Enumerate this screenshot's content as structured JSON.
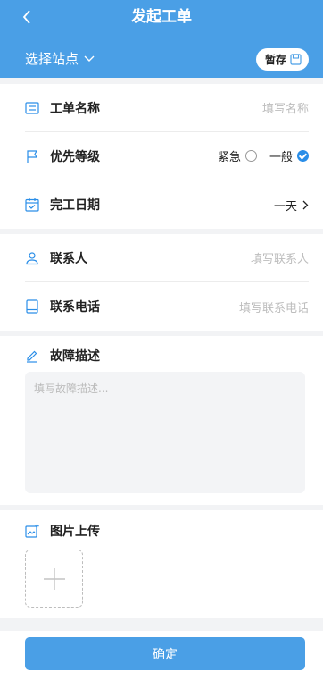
{
  "header": {
    "title": "发起工单",
    "station_label": "选择站点",
    "save_label": "暂存"
  },
  "form": {
    "name": {
      "label": "工单名称",
      "placeholder": "填写名称"
    },
    "priority": {
      "label": "优先等级",
      "options": [
        "紧急",
        "一般"
      ],
      "selected": "一般"
    },
    "deadline": {
      "label": "完工日期",
      "value": "一天"
    },
    "contact": {
      "label": "联系人",
      "placeholder": "填写联系人"
    },
    "phone": {
      "label": "联系电话",
      "placeholder": "填写联系电话"
    },
    "fault": {
      "label": "故障描述",
      "placeholder": "填写故障描述..."
    },
    "images": {
      "label": "图片上传"
    }
  },
  "footer": {
    "confirm_label": "确定"
  },
  "colors": {
    "primary": "#4a9fe6",
    "check": "#2a8ee8",
    "gap": "#f2f3f5"
  },
  "icons": [
    "back-icon",
    "chevron-down-icon",
    "save-icon",
    "list-icon",
    "flag-icon",
    "calendar-icon",
    "chevron-right-icon",
    "user-icon",
    "phone-icon",
    "pen-icon",
    "image-upload-icon",
    "plus-icon"
  ]
}
